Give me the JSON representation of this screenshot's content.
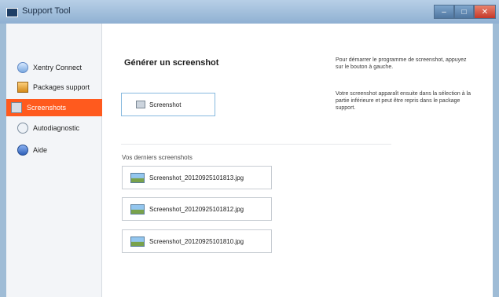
{
  "window": {
    "title": "Support Tool",
    "controls": {
      "minimize": "–",
      "maximize": "□",
      "close": "✕"
    }
  },
  "sidebar": {
    "items": [
      {
        "label": "Xentry Connect",
        "icon": "globe-icon"
      },
      {
        "label": "Packages support",
        "icon": "package-icon"
      },
      {
        "label": "Screenshots",
        "icon": "screenshot-icon",
        "selected": true
      },
      {
        "label": "Autodiagnostic",
        "icon": "diagnostic-icon"
      },
      {
        "label": "Aide",
        "icon": "help-icon"
      }
    ]
  },
  "main": {
    "heading": "Générer un screenshot",
    "take_button_label": "Screenshot",
    "help_text_1": "Pour démarrer le programme de screenshot, appuyez sur le bouton à gauche.",
    "help_text_2": "Votre screenshot apparaît ensuite dans la sélection à la partie inférieure et peut être repris dans le package support.",
    "recent_label": "Vos derniers screenshots",
    "recent_files": [
      "Screenshot_20120925101813.jpg",
      "Screenshot_20120925101812.jpg",
      "Screenshot_20120925101810.jpg"
    ]
  },
  "colors": {
    "accent": "#ff5a1e",
    "button_border": "#86b9de",
    "sidebar_bg": "#f3f5f8",
    "window_frame": "#9fbcd6"
  }
}
